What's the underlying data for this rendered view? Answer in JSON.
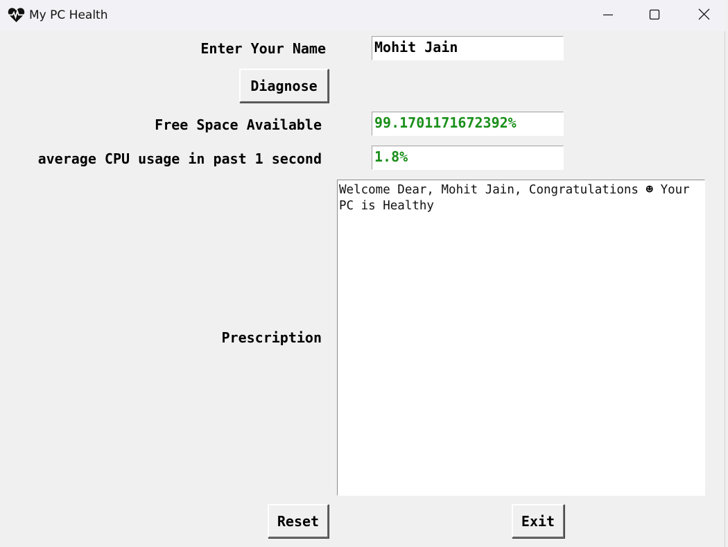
{
  "window": {
    "title": "My PC Health",
    "icon": "heart-pulse-icon"
  },
  "form": {
    "name_label": "Enter Your Name",
    "name_value": "Mohit Jain",
    "diagnose_label": "Diagnose",
    "free_space_label": "Free Space Available",
    "free_space_value": "99.1701171672392%",
    "cpu_label": "average CPU usage in past 1 second",
    "cpu_value": "1.8%",
    "prescription_label": "Prescription",
    "prescription_text": "Welcome Dear, Mohit Jain, Congratulations ☻ Your PC is Healthy",
    "reset_label": "Reset",
    "exit_label": "Exit"
  },
  "colors": {
    "value_green": "#1a8f1a",
    "background": "#f0f0f0"
  }
}
